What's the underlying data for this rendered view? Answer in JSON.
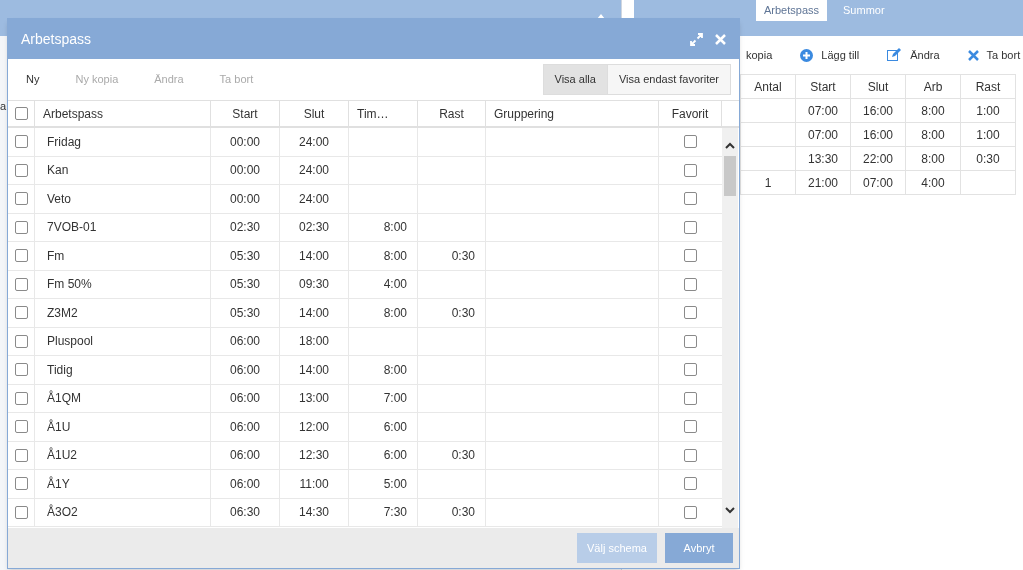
{
  "background": {
    "left_fragment": "a",
    "tabs": [
      {
        "label": "Arbetspass",
        "selected": true
      },
      {
        "label": "Summor",
        "selected": false
      }
    ],
    "toolbar": [
      {
        "label": "kopia",
        "kind": "plain"
      },
      {
        "label": "Lägg till",
        "kind": "add"
      },
      {
        "label": "Ändra",
        "kind": "edit"
      },
      {
        "label": "Ta bort",
        "kind": "delete"
      }
    ],
    "table": {
      "columns": [
        "Antal",
        "Start",
        "Slut",
        "Arb",
        "Rast"
      ],
      "rows": [
        [
          "",
          "07:00",
          "16:00",
          "8:00",
          "1:00"
        ],
        [
          "",
          "07:00",
          "16:00",
          "8:00",
          "1:00"
        ],
        [
          "",
          "13:30",
          "22:00",
          "8:00",
          "0:30"
        ],
        [
          "1",
          "21:00",
          "07:00",
          "4:00",
          ""
        ]
      ]
    }
  },
  "dialog": {
    "title": "Arbetspass",
    "toolbar": [
      {
        "label": "Ny",
        "disabled": false
      },
      {
        "label": "Ny kopia",
        "disabled": true
      },
      {
        "label": "Ändra",
        "disabled": true
      },
      {
        "label": "Ta bort",
        "disabled": true
      }
    ],
    "filters": [
      {
        "label": "Visa alla",
        "selected": true
      },
      {
        "label": "Visa endast favoriter",
        "selected": false
      }
    ],
    "all_checked": false,
    "columns": [
      "Arbetspass",
      "Start",
      "Slut",
      "Tim…",
      "Rast",
      "Gruppering",
      "Favorit"
    ],
    "rows": [
      {
        "checked": false,
        "cells": [
          "Fridag",
          "00:00",
          "24:00",
          "",
          "",
          ""
        ],
        "favorite": false
      },
      {
        "checked": false,
        "cells": [
          "Kan",
          "00:00",
          "24:00",
          "",
          "",
          ""
        ],
        "favorite": false
      },
      {
        "checked": false,
        "cells": [
          "Veto",
          "00:00",
          "24:00",
          "",
          "",
          ""
        ],
        "favorite": false
      },
      {
        "checked": false,
        "cells": [
          "7VOB-01",
          "02:30",
          "02:30",
          "8:00",
          "",
          ""
        ],
        "favorite": false
      },
      {
        "checked": false,
        "cells": [
          "Fm",
          "05:30",
          "14:00",
          "8:00",
          "0:30",
          ""
        ],
        "favorite": false
      },
      {
        "checked": false,
        "cells": [
          "Fm 50%",
          "05:30",
          "09:30",
          "4:00",
          "",
          ""
        ],
        "favorite": false
      },
      {
        "checked": false,
        "cells": [
          "Z3M2",
          "05:30",
          "14:00",
          "8:00",
          "0:30",
          ""
        ],
        "favorite": false
      },
      {
        "checked": false,
        "cells": [
          "Pluspool",
          "06:00",
          "18:00",
          "",
          "",
          ""
        ],
        "favorite": false
      },
      {
        "checked": false,
        "cells": [
          "Tidig",
          "06:00",
          "14:00",
          "8:00",
          "",
          ""
        ],
        "favorite": false
      },
      {
        "checked": false,
        "cells": [
          "Å1QM",
          "06:00",
          "13:00",
          "7:00",
          "",
          ""
        ],
        "favorite": false
      },
      {
        "checked": false,
        "cells": [
          "Å1U",
          "06:00",
          "12:00",
          "6:00",
          "",
          ""
        ],
        "favorite": false
      },
      {
        "checked": false,
        "cells": [
          "Å1U2",
          "06:00",
          "12:30",
          "6:00",
          "0:30",
          ""
        ],
        "favorite": false
      },
      {
        "checked": false,
        "cells": [
          "Å1Y",
          "06:00",
          "11:00",
          "5:00",
          "",
          ""
        ],
        "favorite": false
      },
      {
        "checked": false,
        "cells": [
          "Å3O2",
          "06:30",
          "14:30",
          "7:30",
          "0:30",
          ""
        ],
        "favorite": false
      }
    ],
    "buttons": [
      {
        "label": "Välj schema",
        "disabled": true
      },
      {
        "label": "Avbryt",
        "disabled": false
      }
    ]
  }
}
